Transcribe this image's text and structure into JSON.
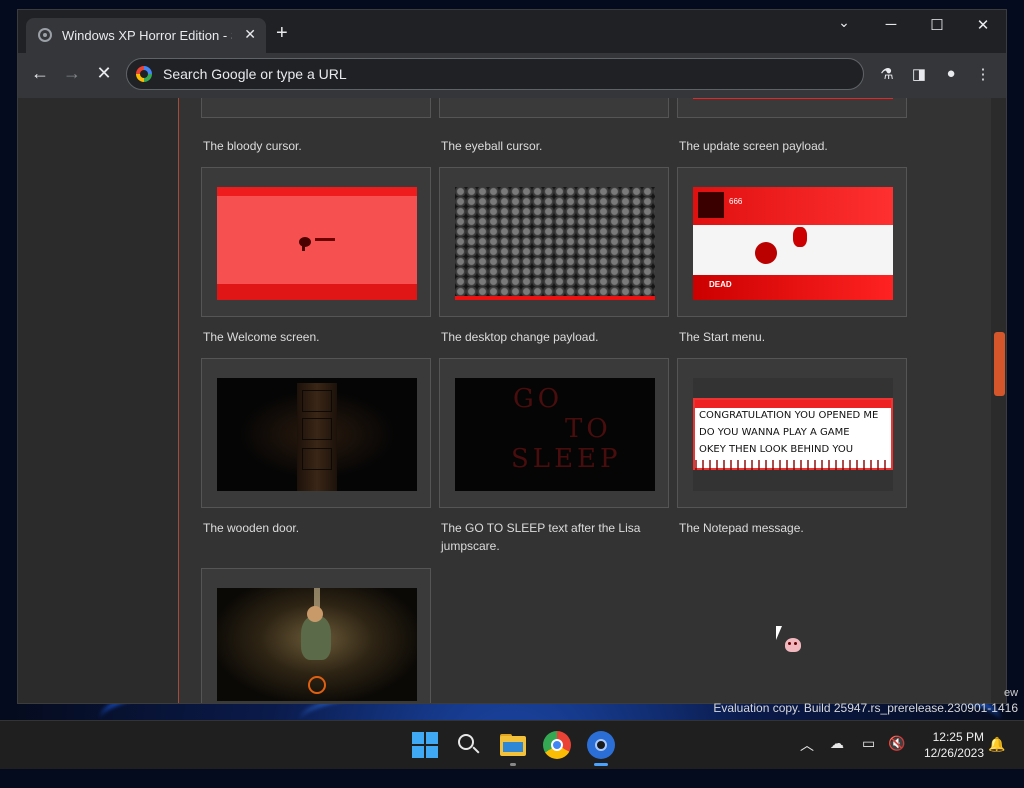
{
  "browser": {
    "tab_title": "Windows XP Horror Edition - Screenshots",
    "omnibox_placeholder": "Search Google or type a URL"
  },
  "gallery": {
    "captions_top": [
      "The bloody cursor.",
      "The eyeball cursor.",
      "The update screen payload."
    ],
    "items": [
      {
        "caption": "The Welcome screen."
      },
      {
        "caption": "The desktop change payload."
      },
      {
        "caption": "The Start menu."
      },
      {
        "caption": "The wooden door."
      },
      {
        "caption": "The GO TO SLEEP text after the Lisa jumpscare."
      },
      {
        "caption": "The Notepad message."
      }
    ],
    "start_menu_thumb": {
      "number": "666",
      "label": "DEAD"
    },
    "sleep_thumb": {
      "line1": "GO",
      "line2": "TO",
      "line3": "SLEEP"
    },
    "notepad_thumb": {
      "line1": "CONGRATULATION YOU OPENED ME",
      "line2": "DO YOU WANNA PLAY A GAME",
      "line3": "OKEY THEN LOOK BEHIND YOU"
    }
  },
  "desktop": {
    "watermark_ew": "ew",
    "evaluation": "Evaluation copy. Build 25947.rs_prerelease.230901-1416"
  },
  "taskbar": {
    "time": "12:25 PM",
    "date": "12/26/2023"
  },
  "colors": {
    "accent_scroll": "#d4562a",
    "page_bg": "#333333"
  }
}
